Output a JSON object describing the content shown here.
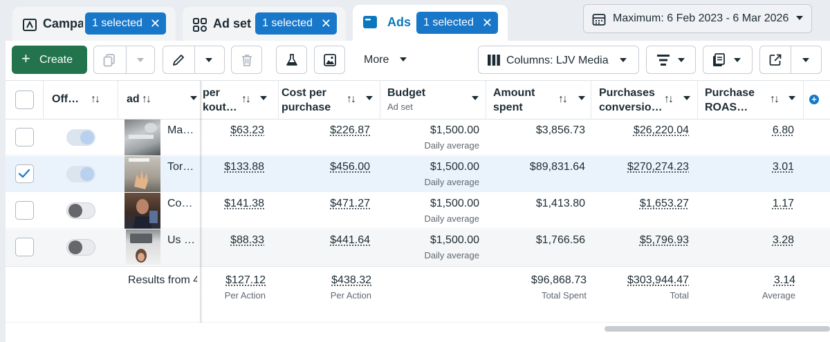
{
  "tabs": [
    {
      "label": "Campa",
      "badge": "1 selected",
      "icon": "campaign-flag-icon"
    },
    {
      "label": "Ad set",
      "badge": "1 selected",
      "icon": "grid-icon"
    },
    {
      "label": "Ads",
      "badge": "1 selected",
      "icon": "ad-window-icon",
      "active": true
    }
  ],
  "badge_close": "✕",
  "date_range": {
    "label": "Maximum: 6 Feb 2023 - 6 Mar 2026"
  },
  "toolbar": {
    "create_label": "Create",
    "create_plus": "+",
    "more_label": "More",
    "columns_label": "Columns: LJV Media"
  },
  "colors": {
    "accent": "#1877c9",
    "create_green": "#23744d",
    "tab_active_text": "#0a78be"
  },
  "columns": {
    "off_on": "Off…",
    "ad": "ad",
    "checkout_1": "per",
    "checkout_2": "kout…",
    "cost_1": "Cost per",
    "cost_2": "purchase",
    "budget_1": "Budget",
    "budget_sub": "Ad set",
    "spent_1": "Amount",
    "spent_2": "spent",
    "pcv_1": "Purchases",
    "pcv_2": "conversio…",
    "roas_1": "Purchase",
    "roas_2": "ROAS…",
    "add_column": "+"
  },
  "rows": [
    {
      "name": "Ma…",
      "checked": false,
      "on": true,
      "checkout": "$63.23",
      "cost": "$226.87",
      "budget": "$1,500.00",
      "budget_sub": "Daily average",
      "spent": "$3,856.73",
      "pcv": "$26,220.04",
      "roas": "6.80"
    },
    {
      "name": "Tor…",
      "checked": true,
      "on": true,
      "checkout": "$133.88",
      "cost": "$456.00",
      "budget": "$1,500.00",
      "budget_sub": "Daily average",
      "spent": "$89,831.64",
      "pcv": "$270,274.23",
      "roas": "3.01"
    },
    {
      "name": "Co…",
      "checked": false,
      "on": false,
      "checkout": "$141.38",
      "cost": "$471.27",
      "budget": "$1,500.00",
      "budget_sub": "Daily average",
      "spent": "$1,413.80",
      "pcv": "$1,653.27",
      "roas": "1.17"
    },
    {
      "name": "Us …",
      "checked": false,
      "on": false,
      "checkout": "$88.33",
      "cost": "$441.64",
      "budget": "$1,500.00",
      "budget_sub": "Daily average",
      "spent": "$1,766.56",
      "pcv": "$5,796.93",
      "roas": "3.28"
    }
  ],
  "totals": {
    "label": "Results from 4",
    "checkout": "$127.12",
    "checkout_sub": "Per Action",
    "cost": "$438.32",
    "cost_sub": "Per Action",
    "spent": "$96,868.73",
    "spent_sub": "Total Spent",
    "pcv": "$303,944.47",
    "pcv_sub": "Total",
    "roas": "3.14",
    "roas_sub": "Average"
  }
}
